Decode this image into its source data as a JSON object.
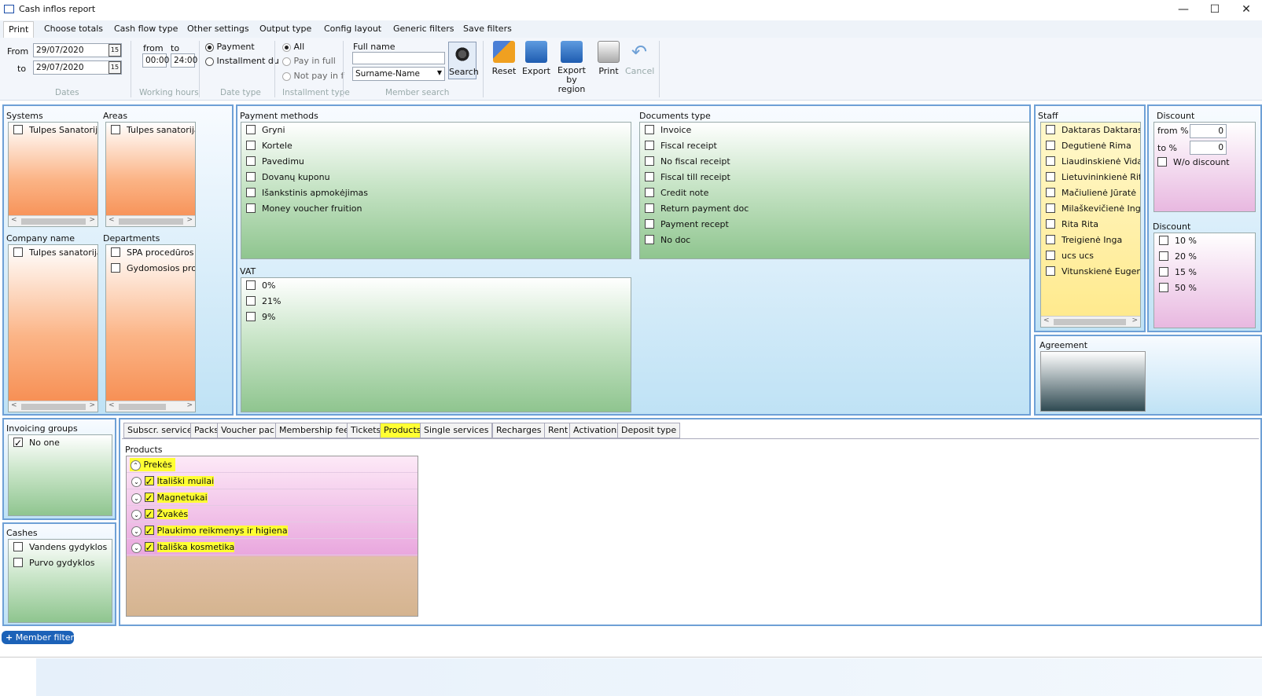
{
  "window": {
    "title": "Cash inflos report",
    "minimize": "—",
    "maximize": "☐",
    "close": "✕"
  },
  "menu": [
    "Print",
    "Choose totals",
    "Cash flow type",
    "Other settings",
    "Output type",
    "Config layout",
    "Generic filters",
    "Save filters"
  ],
  "ribbon": {
    "dates": {
      "from_label": "From",
      "to_label": "to",
      "from_value": "29/07/2020",
      "to_value": "29/07/2020",
      "cal_text": "15",
      "group": "Dates"
    },
    "hours": {
      "from_label": "from",
      "to_label": "to",
      "from_value": "00:00",
      "to_value": "24:00",
      "group": "Working hours"
    },
    "date_type": {
      "options": [
        "Payment",
        "Installment du"
      ],
      "selected": "Payment",
      "group": "Date type"
    },
    "installment": {
      "options": [
        "All",
        "Pay in full",
        "Not pay in f"
      ],
      "selected": "All",
      "group": "Installment type"
    },
    "member_search": {
      "full_name_label": "Full name",
      "full_name_value": "",
      "format": "Surname-Name",
      "search": "Search",
      "group": "Member search"
    },
    "actions": {
      "reset": "Reset",
      "export": "Export",
      "export_region_1": "Export by",
      "export_region_2": "region",
      "print": "Print",
      "cancel": "Cancel"
    }
  },
  "systems": {
    "label": "Systems",
    "items": [
      "Tulpes Sanatorija"
    ]
  },
  "areas": {
    "label": "Areas",
    "items": [
      "Tulpes sanatorija"
    ]
  },
  "company": {
    "label": "Company name",
    "items": [
      "Tulpes sanatorija V"
    ]
  },
  "departments": {
    "label": "Departments",
    "items": [
      "SPA procedūros",
      "Gydomosios proce"
    ]
  },
  "payment_methods": {
    "label": "Payment methods",
    "items": [
      "Gryni",
      "Kortele",
      "Pavedimu",
      "Dovanų kuponu",
      "Išankstinis apmokėjimas",
      "Money voucher fruition"
    ]
  },
  "documents_type": {
    "label": "Documents type",
    "items": [
      "Invoice",
      "Fiscal receipt",
      "No fiscal receipt",
      "Fiscal till receipt",
      "Credit note",
      "Return payment doc",
      "Payment recept",
      "No doc"
    ]
  },
  "vat": {
    "label": "VAT",
    "items": [
      "0%",
      "21%",
      "9%"
    ]
  },
  "staff": {
    "label": "Staff",
    "items": [
      "Daktaras Daktaras",
      "Degutienė Rima",
      "Liaudinskienė Vida",
      "Lietuvininkienė Rita",
      "Mačiulienė Jūratė",
      "Milaškevičienė Inga",
      "Rita Rita",
      "Treigienė Inga",
      "ucs ucs",
      "Vitunskienė Eugenija"
    ]
  },
  "discount1": {
    "label": "Discount",
    "from_label": "from %",
    "from_value": "0",
    "to_label": "to %",
    "to_value": "0",
    "wo_label": "W/o discount"
  },
  "discount2": {
    "label": "Discount",
    "items": [
      "10 %",
      "20 %",
      "15 %",
      "50 %"
    ]
  },
  "agreement": {
    "label": "Agreement"
  },
  "invoicing": {
    "label": "Invoicing groups",
    "items": [
      "No one"
    ]
  },
  "cashes": {
    "label": "Cashes",
    "items": [
      "Vandens gydyklos",
      "Purvo gydyklos"
    ]
  },
  "tabs": {
    "items": [
      "Subscr. services",
      "Packs",
      "Voucher pack",
      "Membership fees",
      "Tickets",
      "Products",
      "Single services",
      "Recharges",
      "Rent",
      "Activations",
      "Deposit type"
    ],
    "selected": "Products"
  },
  "products": {
    "label": "Products",
    "root": "Prekės",
    "children": [
      "Itališki muilai",
      "Magnetukai",
      "Žvakės",
      "Plaukimo reikmenys ir higiena",
      "Itališka kosmetika"
    ]
  },
  "member_filters": "Member filters",
  "colors": {
    "accent_blue": "#1c62b8",
    "highlight": "#ffff33"
  }
}
